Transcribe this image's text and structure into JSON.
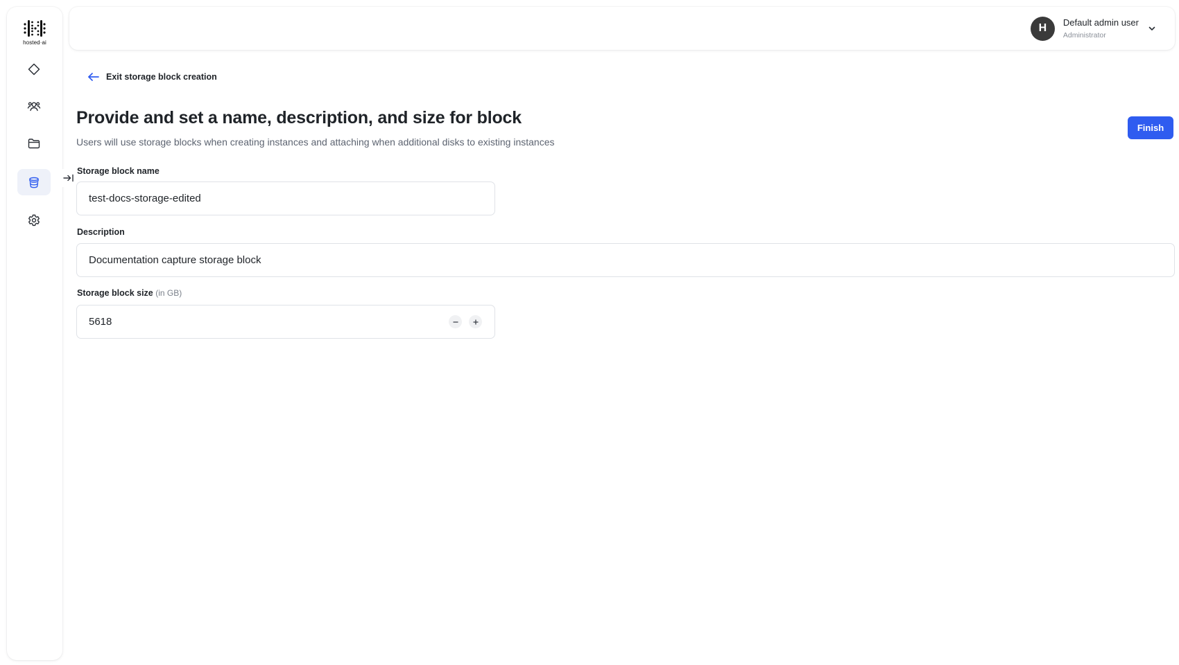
{
  "app": {
    "logo_text": "hosted·ai"
  },
  "sidebar": {
    "items": [
      {
        "icon": "diamond-icon",
        "active": false
      },
      {
        "icon": "users-icon",
        "active": false
      },
      {
        "icon": "folder-icon",
        "active": false
      },
      {
        "icon": "storage-icon",
        "active": true
      },
      {
        "icon": "gear-icon",
        "active": false
      }
    ],
    "collapse_icon": "collapse-arrow-icon"
  },
  "header": {
    "user": {
      "avatar_initial": "H",
      "name": "Default admin user",
      "role": "Administrator"
    }
  },
  "page": {
    "back_label": "Exit storage block creation",
    "title": "Provide and set a name, description, and size for block",
    "subtitle": "Users will use storage blocks when creating instances and attaching when additional disks to existing instances",
    "finish_label": "Finish"
  },
  "form": {
    "name": {
      "label": "Storage block name",
      "value": "test-docs-storage-edited"
    },
    "description": {
      "label": "Description",
      "value": "Documentation capture storage block"
    },
    "size": {
      "label": "Storage block size",
      "hint": "(in GB)",
      "value": "5618"
    }
  },
  "colors": {
    "accent": "#2f5cf0",
    "active_nav_bg": "#eef1f9",
    "avatar_bg": "#3a3a3a"
  }
}
